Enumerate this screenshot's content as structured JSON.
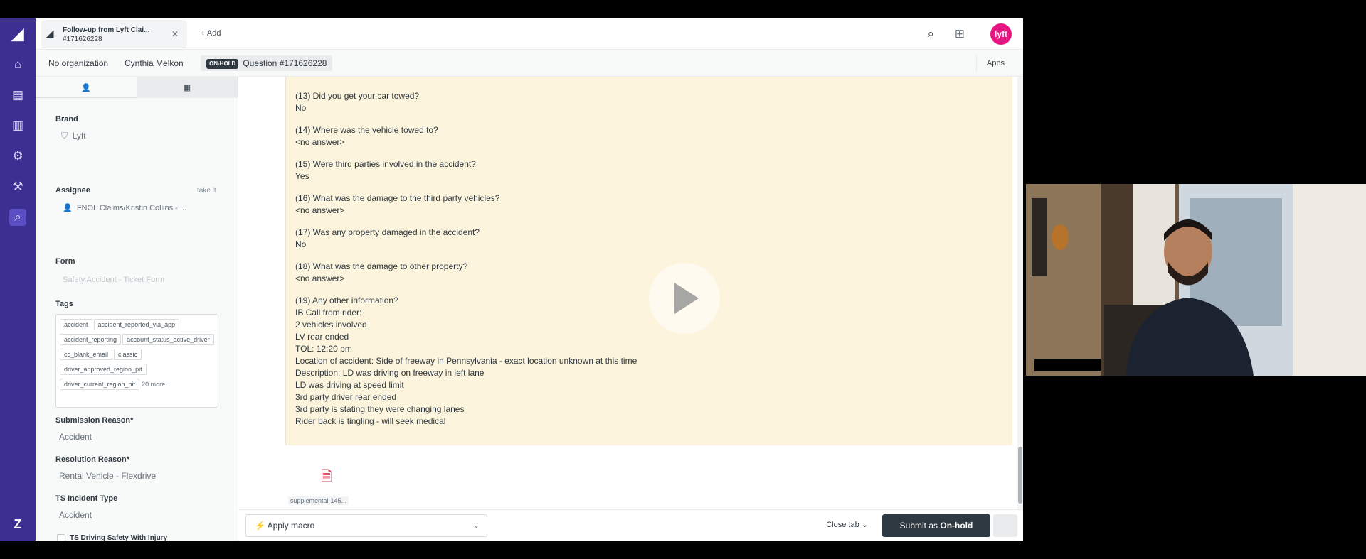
{
  "tab": {
    "title": "Follow-up from Lyft Clai...",
    "id": "#171626228",
    "add_label": "Add"
  },
  "breadcrumbs": {
    "organization": "No organization",
    "requester": "Cynthia Melkon",
    "status_badge": "ON-HOLD",
    "ticket": "Question #171626228"
  },
  "header": {
    "apps_label": "Apps",
    "avatar_text": "lyft"
  },
  "sidebar": {
    "brand_label": "Brand",
    "brand_value": "Lyft",
    "assignee_label": "Assignee",
    "take_it": "take it",
    "assignee_value": "FNOL Claims/Kristin Collins - ...",
    "form_label": "Form",
    "form_value": "Safety Accident - Ticket Form",
    "tags_label": "Tags",
    "tags": [
      "accident",
      "accident_reported_via_app",
      "accident_reporting",
      "account_status_active_driver",
      "cc_blank_email",
      "classic",
      "driver_approved_region_pit",
      "driver_current_region_pit"
    ],
    "tags_more": "20 more...",
    "submission_reason_label": "Submission Reason*",
    "submission_reason_value": "Accident",
    "resolution_reason_label": "Resolution Reason*",
    "resolution_reason_value": "Rental Vehicle - Flexdrive",
    "ts_incident_label": "TS Incident Type",
    "ts_incident_value": "Accident",
    "ts_driving_label": "TS Driving Safety With Injury"
  },
  "comment": {
    "lines": [
      "(13) Did you get your car towed?",
      "No",
      "(14) Where was the vehicle towed to?",
      "<no answer>",
      "(15) Were third parties involved in the accident?",
      "Yes",
      "(16) What was the damage to the third party vehicles?",
      "<no answer>",
      "(17) Was any property damaged in the accident?",
      "No",
      "(18) What was the damage to other property?",
      "<no answer>",
      "(19) Any other information?",
      "IB Call from rider:",
      "2 vehicles involved",
      "LV rear ended",
      "TOL: 12:20 pm",
      "Location of accident: Side of freeway in Pennsylvania - exact location unknown at this time",
      "Description: LD was driving on freeway in left lane",
      "LD was driving at speed limit",
      "3rd party driver rear ended",
      "3rd party is stating they were changing lanes",
      "Rider back is tingling - will seek medical"
    ],
    "attachment_name": "supplemental-145..."
  },
  "footer": {
    "macro_label": "Apply macro",
    "close_tab_label": "Close tab",
    "submit_prefix": "Submit as ",
    "submit_status": "On-hold"
  },
  "icons": {
    "rail": [
      "zendesk-logo",
      "home-icon",
      "views-icon",
      "reporting-icon",
      "admin-icon",
      "tool-icon",
      "search-icon",
      "zendesk-footer-logo"
    ]
  },
  "colors": {
    "rail": "#3b2f91",
    "avatar": "#e6157f",
    "comment_bg": "#fcf4dc",
    "submit_bg": "#2f3941"
  }
}
